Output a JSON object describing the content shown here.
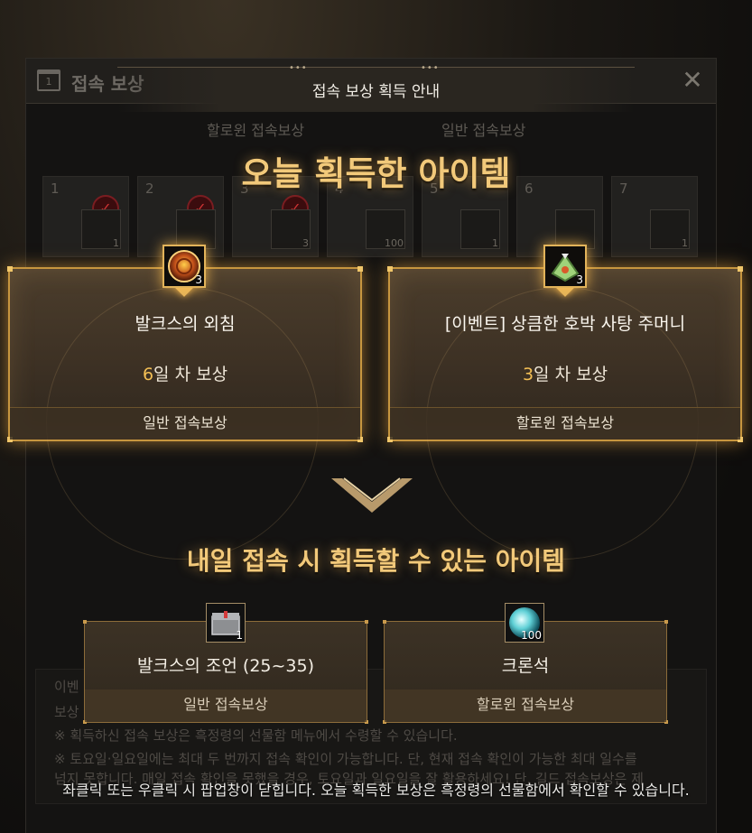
{
  "background_window": {
    "title": "접속 보상",
    "calendar_icon_number": "1",
    "close_icon": "close-icon",
    "tabs": [
      "할로윈 접속보상",
      "일반 접속보상"
    ],
    "days": [
      "1",
      "2",
      "3",
      "4",
      "5",
      "6",
      "7"
    ],
    "day_item_quantities": [
      "1",
      "",
      "3",
      "100",
      "1",
      "",
      "1"
    ],
    "notice_lines": [
      "이벤",
      "보상",
      "※ 획득하신 접속 보상은 흑정령의 선물함 메뉴에서 수령할 수 있습니다.",
      "※ 토요일·일요일에는 최대 두 번까지 접속 확인이 가능합니다. 단, 현재 접속 확인이 가능한 최대 일수를",
      "넘지 못합니다. 매일 접속 확인을 못했을 경우, 토요일과 일요일을 잘 활용하세요! 단, 길드 접속보상은 제"
    ]
  },
  "popup": {
    "header_title": "접속 보상 획득 안내",
    "today_title": "오늘 획득한 아이템",
    "today_items": [
      {
        "name": "발크스의 외침",
        "day": "6",
        "day_suffix": "일 차 보상",
        "category": "일반 접속보상",
        "quantity": "3",
        "icon": "valks-cry-icon"
      },
      {
        "name": "[이벤트] 상큼한 호박 사탕 주머니",
        "day": "3",
        "day_suffix": "일 차 보상",
        "category": "할로윈 접속보상",
        "quantity": "3",
        "icon": "candy-pouch-icon"
      }
    ],
    "tomorrow_title": "내일 접속 시 획득할 수 있는 아이템",
    "tomorrow_items": [
      {
        "name": "발크스의 조언 (25~35)",
        "category": "일반 접속보상",
        "quantity": "1",
        "icon": "valks-advice-chest-icon"
      },
      {
        "name": "크론석",
        "category": "할로윈 접속보상",
        "quantity": "100",
        "icon": "cron-stone-icon"
      }
    ],
    "footer_note": "좌클릭 또는 우클릭 시 팝업창이 닫힙니다. 오늘 획득한 보상은 흑정령의 선물함에서 확인할 수 있습니다."
  },
  "colors": {
    "accent_gold": "#f2c97a",
    "card_border": "#c7963f",
    "day_number": "#f3bf55"
  }
}
